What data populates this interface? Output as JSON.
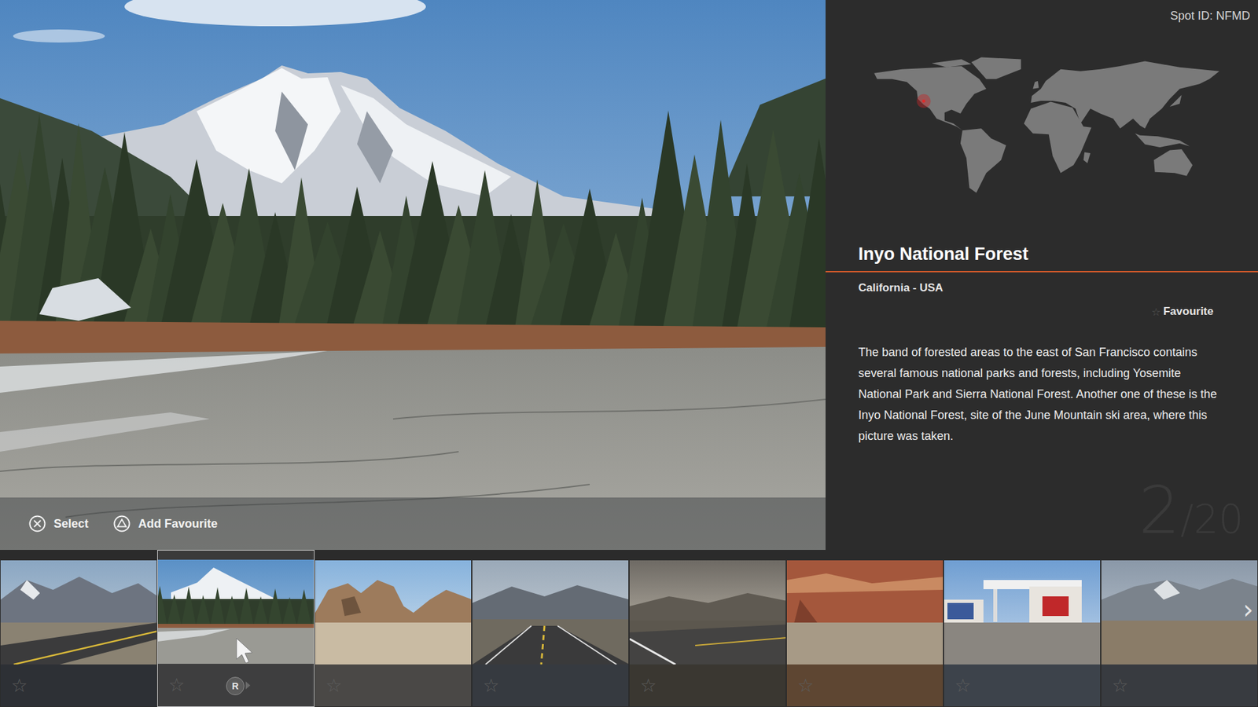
{
  "spot_id": "Spot ID: NFMD",
  "location": {
    "lon": -118,
    "lat": 37.7
  },
  "title": "Inyo National Forest",
  "region": "California - USA",
  "favourite": {
    "icon": "☆",
    "label": "Favourite",
    "on": false
  },
  "description": "The band of forested areas to the east of San Francisco contains several famous national parks and forests, including Yosemite National Park and Sierra National Forest. Another one of these is the Inyo National Forest, site of the June Mountain ski area, where this picture was taken.",
  "counter": {
    "current": "2",
    "total": "/20"
  },
  "controls": [
    {
      "kind": "cross",
      "label": "Select"
    },
    {
      "kind": "triangle",
      "label": "Add Favourite"
    }
  ],
  "thumbnails": [
    {
      "kind": "mountain-road",
      "selected": false,
      "star": "☆",
      "favourite": false,
      "color": "#2d3035"
    },
    {
      "kind": "forest",
      "selected": true,
      "star": "☆",
      "favourite": false,
      "color": "#3e3e3f"
    },
    {
      "kind": "rocks",
      "selected": false,
      "star": "☆",
      "favourite": false,
      "color": "#4a4846"
    },
    {
      "kind": "straight-road",
      "selected": false,
      "star": "☆",
      "favourite": false,
      "color": "#363a40"
    },
    {
      "kind": "desert-road",
      "selected": false,
      "star": "☆",
      "favourite": false,
      "color": "#3a3731"
    },
    {
      "kind": "canyon",
      "selected": false,
      "star": "☆",
      "favourite": false,
      "color": "#5e4632"
    },
    {
      "kind": "gas-station",
      "selected": false,
      "star": "☆",
      "favourite": false,
      "color": "#3d434b"
    },
    {
      "kind": "mountain",
      "selected": false,
      "star": "☆",
      "favourite": false,
      "color": "#383b40"
    }
  ],
  "cursor_badge": "R",
  "next_icon": "›"
}
